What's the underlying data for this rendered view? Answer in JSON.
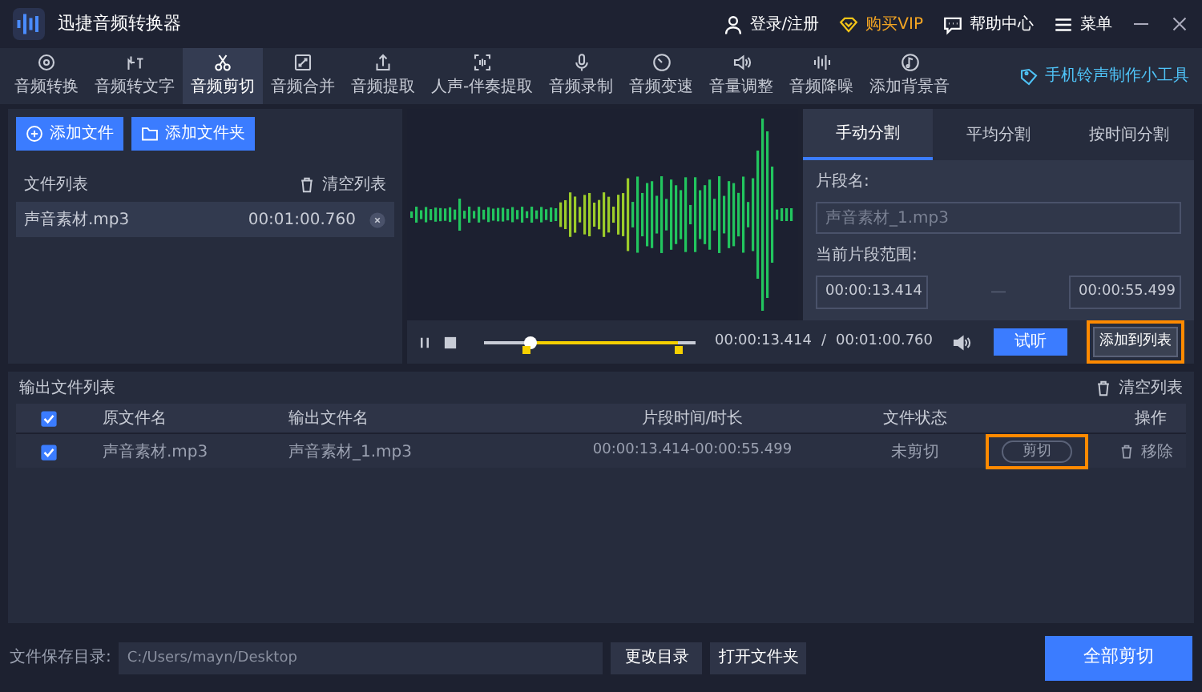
{
  "window": {
    "title": "迅捷音频转换器",
    "actions": [
      {
        "kind": "user",
        "label": "登录/注册"
      },
      {
        "kind": "vip",
        "label": "购买VIP"
      },
      {
        "kind": "help",
        "label": "帮助中心"
      },
      {
        "kind": "menu",
        "label": "菜单"
      }
    ]
  },
  "toolbar": {
    "items": [
      {
        "label": "音频转换",
        "selected": false
      },
      {
        "label": "音频转文字",
        "selected": false
      },
      {
        "label": "音频剪切",
        "selected": true
      },
      {
        "label": "音频合并",
        "selected": false
      },
      {
        "label": "音频提取",
        "selected": false
      },
      {
        "label": "人声-伴奏提取",
        "selected": false
      },
      {
        "label": "音频录制",
        "selected": false
      },
      {
        "label": "音频变速",
        "selected": false
      },
      {
        "label": "音量调整",
        "selected": false
      },
      {
        "label": "音频降噪",
        "selected": false
      },
      {
        "label": "添加背景音",
        "selected": false
      }
    ],
    "tool_link": "手机铃声制作小工具"
  },
  "file_panel": {
    "buttons": [
      {
        "kind": "file",
        "label": "添加文件"
      },
      {
        "kind": "folder",
        "label": "添加文件夹"
      }
    ],
    "header": "文件列表",
    "clear": "清空列表",
    "files": [
      {
        "name": "声音素材.mp3",
        "duration": "00:01:00.760",
        "selected": true
      }
    ]
  },
  "player": {
    "position": {
      "level": 0.22
    },
    "range_start": {
      "level": 0.2
    },
    "range_end": {
      "level": 0.92
    },
    "current": "00:00:13.414",
    "separator": "/",
    "total": "00:01:00.760",
    "preview": "试听",
    "add_to_list": "添加到列表",
    "add_highlighted": true
  },
  "split_panel": {
    "tabs": [
      {
        "label": "手动分割",
        "selected": true
      },
      {
        "label": "平均分割",
        "selected": false
      },
      {
        "label": "按时间分割",
        "selected": false
      }
    ],
    "name_label": "片段名:",
    "name_placeholder": "声音素材_1.mp3",
    "range_label": "当前片段范围:",
    "start": "00:00:13.414",
    "dash": "—",
    "end": "00:00:55.499"
  },
  "output": {
    "title": "输出文件列表",
    "clear": "清空列表",
    "all_checked": true,
    "columns": [
      "原文件名",
      "输出文件名",
      "片段时间/时长",
      "文件状态",
      "操作"
    ],
    "rows": [
      {
        "checked": true,
        "source": "声音素材.mp3",
        "output": "声音素材_1.mp3",
        "segment": "00:00:13.414-00:00:55.499",
        "status": "未剪切",
        "cut": "剪切",
        "cut_highlighted": true,
        "remove": "移除"
      }
    ]
  },
  "footer": {
    "label": "文件保存目录:",
    "path": "C:/Users/mayn/Desktop",
    "change": "更改目录",
    "open": "打开文件夹",
    "cut_all": "全部剪切"
  }
}
